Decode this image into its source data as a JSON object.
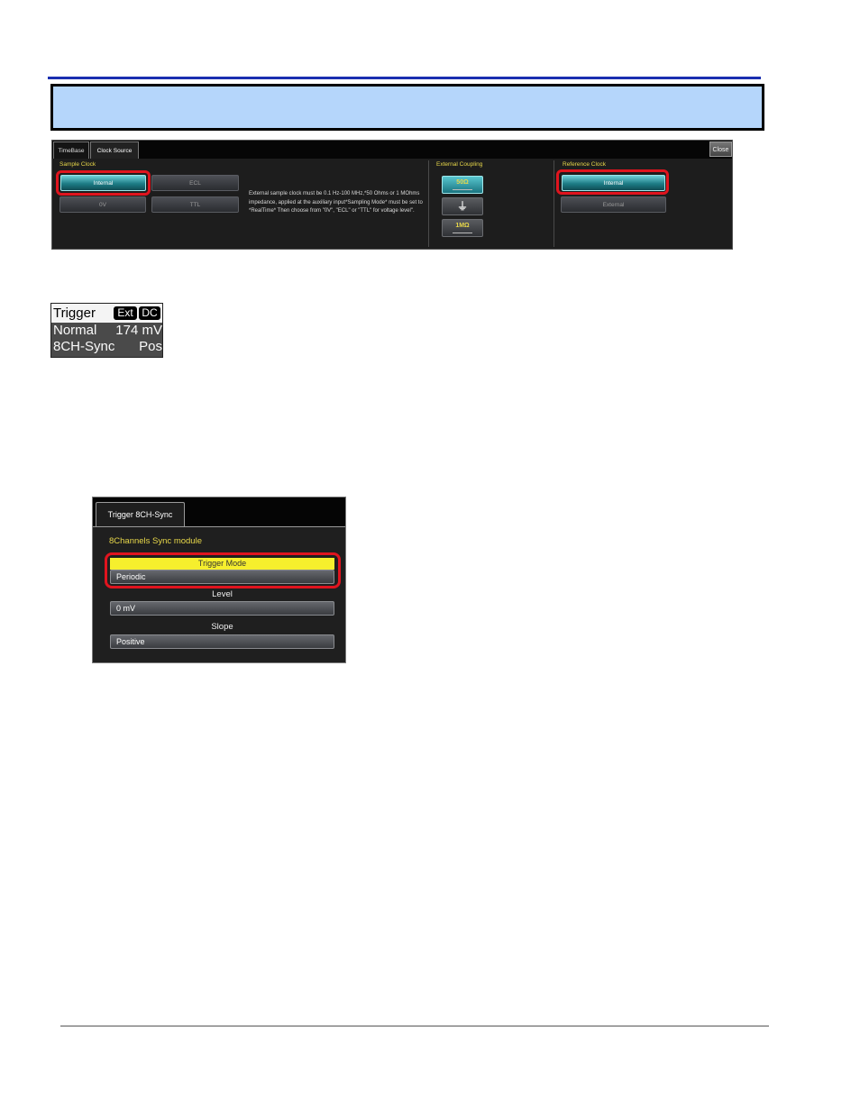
{
  "clock_dialog": {
    "tabs": [
      "TimeBase",
      "Clock Source"
    ],
    "close_label": "Close",
    "sample_clock": {
      "label": "Sample Clock",
      "buttons": [
        "Internal",
        "ECL",
        "0V",
        "TTL"
      ],
      "selected": "Internal"
    },
    "help_text": "External sample clock must be 0.1 Hz-100 MHz,*50 Ohms or 1 MOhms impedance, applied at the auxiliary input*Sampling Mode* must be set to *RealTime* Then choose from \"0V\", \"ECL\" or \"TTL\" for voltage level\".",
    "external_coupling": {
      "label": "External Coupling",
      "options": [
        "50Ω",
        "⏚",
        "1MΩ"
      ],
      "selected": "50Ω"
    },
    "reference_clock": {
      "label": "Reference Clock",
      "buttons": [
        "Internal",
        "External"
      ],
      "selected": "Internal"
    }
  },
  "trigger_descriptor": {
    "title": "Trigger",
    "badge_ext": "Ext",
    "badge_dc": "DC",
    "mode": "Normal",
    "level": "174 mV",
    "source": "8CH-Sync",
    "slope": "Pos"
  },
  "sync_dialog": {
    "tab": "Trigger 8CH-Sync",
    "module_label": "8Channels Sync module",
    "trigger_mode_label": "Trigger Mode",
    "trigger_mode_value": "Periodic",
    "level_label": "Level",
    "level_value": "0 mV",
    "slope_label": "Slope",
    "slope_value": "Positive"
  },
  "colors": {
    "note_box": "#b5d6fb",
    "highlight_ring": "#e0141e",
    "selected_button": "#1e7c86",
    "group_label": "#e8d84a",
    "rule": "#1a2fb0"
  }
}
